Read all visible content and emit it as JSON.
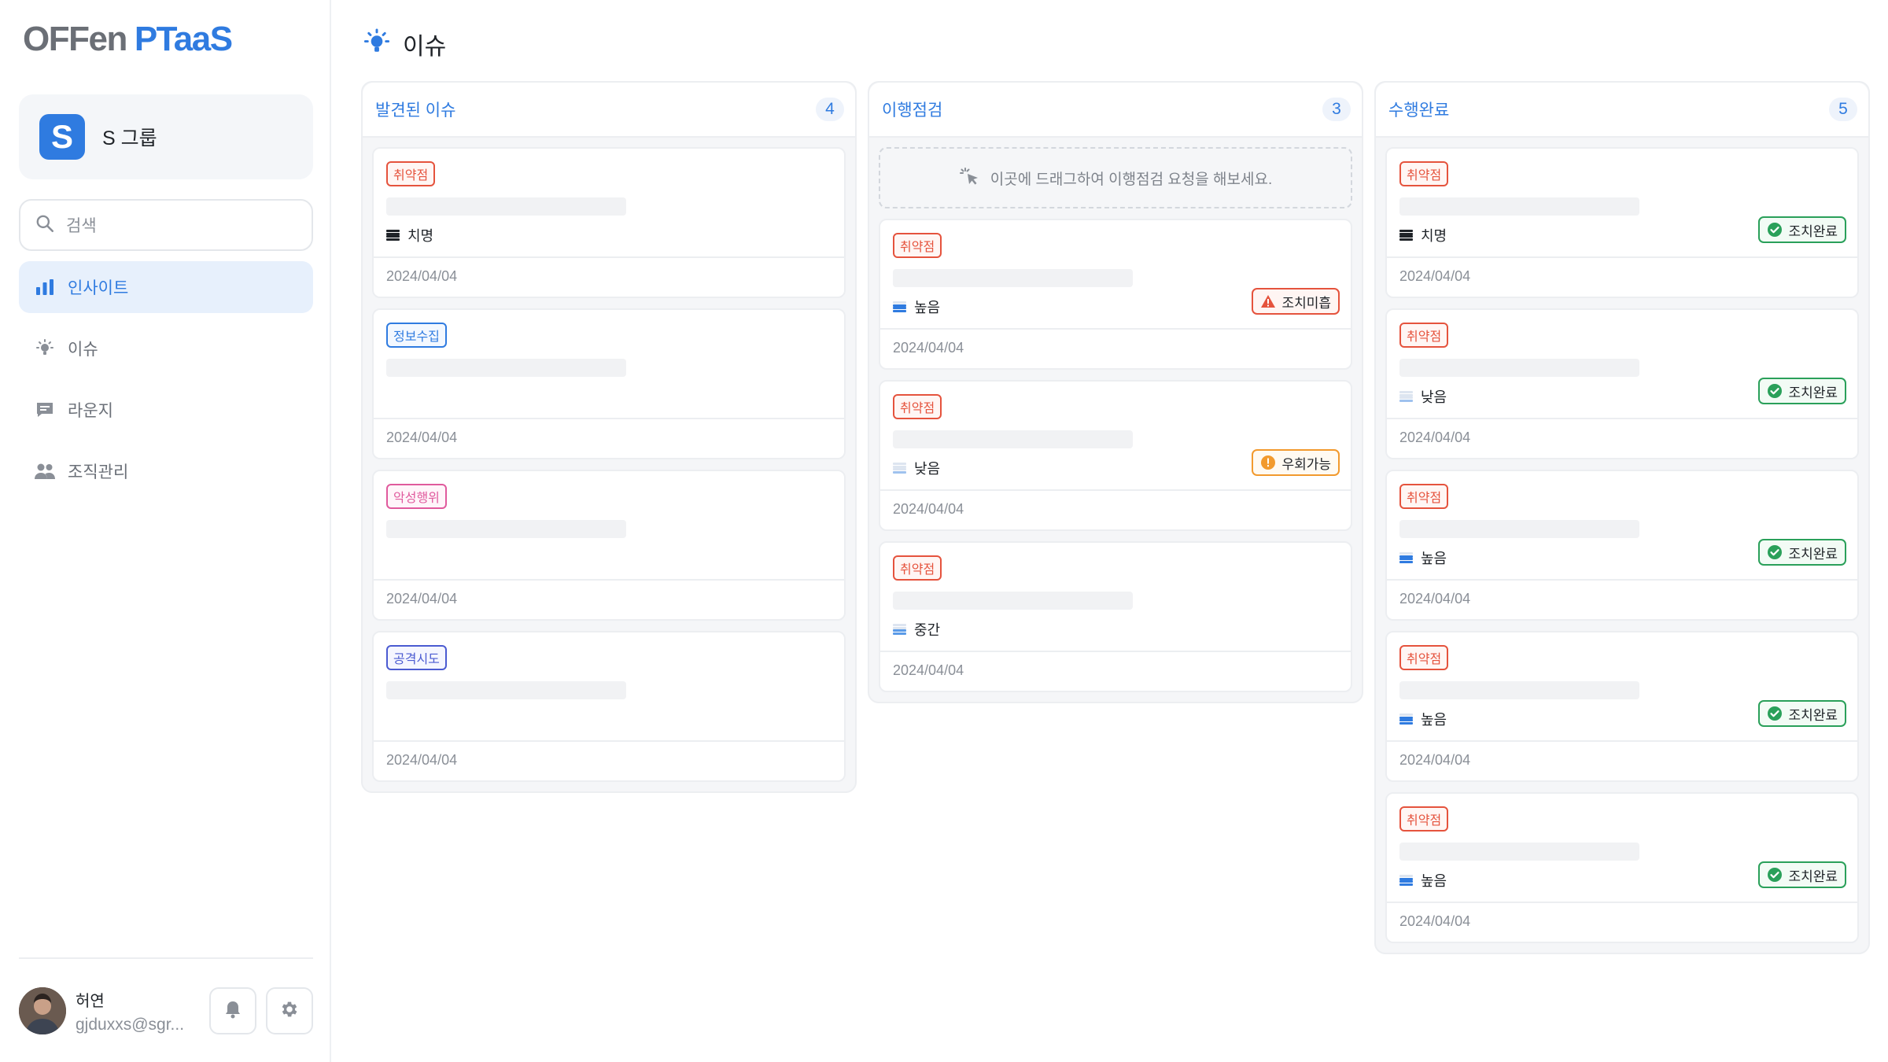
{
  "app": {
    "logo_part1": "OFFen",
    "logo_part2": "PTaaS"
  },
  "org": {
    "badge": "S",
    "name": "S 그룹"
  },
  "search": {
    "placeholder": "검색"
  },
  "nav": [
    {
      "label": "인사이트",
      "icon": "bar-chart-icon",
      "active": true
    },
    {
      "label": "이슈",
      "icon": "lightbulb-icon",
      "active": false
    },
    {
      "label": "라운지",
      "icon": "chat-icon",
      "active": false
    },
    {
      "label": "조직관리",
      "icon": "people-icon",
      "active": false
    }
  ],
  "user": {
    "name": "허연",
    "email": "gjduxxs@sgr..."
  },
  "page": {
    "title": "이슈",
    "icon": "lightbulb-icon"
  },
  "colors": {
    "accent": "#2f7be0",
    "vuln": "#e5533d",
    "info": "#2f7be0",
    "malicious": "#e05a9d",
    "attack": "#4b5bd1",
    "done": "#2aa05a",
    "bypass": "#f29a2e"
  },
  "columns": [
    {
      "title": "발견된 이슈",
      "count": "4",
      "cards": [
        {
          "tag": "취약점",
          "tag_type": "vuln",
          "severity": "치명",
          "severity_level": "critical",
          "status": "",
          "status_type": "",
          "date": "2024/04/04"
        },
        {
          "tag": "정보수집",
          "tag_type": "info",
          "severity": "",
          "severity_level": "",
          "status": "",
          "status_type": "",
          "date": "2024/04/04"
        },
        {
          "tag": "악성행위",
          "tag_type": "mal",
          "severity": "",
          "severity_level": "",
          "status": "",
          "status_type": "",
          "date": "2024/04/04"
        },
        {
          "tag": "공격시도",
          "tag_type": "atk",
          "severity": "",
          "severity_level": "",
          "status": "",
          "status_type": "",
          "date": "2024/04/04"
        }
      ]
    },
    {
      "title": "이행점검",
      "count": "3",
      "drop_hint": "이곳에 드래그하여 이행점검 요청을 해보세요.",
      "cards": [
        {
          "tag": "취약점",
          "tag_type": "vuln",
          "severity": "높음",
          "severity_level": "high",
          "status": "조치미흡",
          "status_type": "undone",
          "date": "2024/04/04"
        },
        {
          "tag": "취약점",
          "tag_type": "vuln",
          "severity": "낮음",
          "severity_level": "low",
          "status": "우회가능",
          "status_type": "bypass",
          "date": "2024/04/04"
        },
        {
          "tag": "취약점",
          "tag_type": "vuln",
          "severity": "중간",
          "severity_level": "medium",
          "status": "",
          "status_type": "",
          "date": "2024/04/04"
        }
      ]
    },
    {
      "title": "수행완료",
      "count": "5",
      "cards": [
        {
          "tag": "취약점",
          "tag_type": "vuln",
          "severity": "치명",
          "severity_level": "critical",
          "status": "조치완료",
          "status_type": "done",
          "date": "2024/04/04"
        },
        {
          "tag": "취약점",
          "tag_type": "vuln",
          "severity": "낮음",
          "severity_level": "low",
          "status": "조치완료",
          "status_type": "done",
          "date": "2024/04/04"
        },
        {
          "tag": "취약점",
          "tag_type": "vuln",
          "severity": "높음",
          "severity_level": "high",
          "status": "조치완료",
          "status_type": "done",
          "date": "2024/04/04"
        },
        {
          "tag": "취약점",
          "tag_type": "vuln",
          "severity": "높음",
          "severity_level": "high",
          "status": "조치완료",
          "status_type": "done",
          "date": "2024/04/04"
        },
        {
          "tag": "취약점",
          "tag_type": "vuln",
          "severity": "높음",
          "severity_level": "high",
          "status": "조치완료",
          "status_type": "done",
          "date": "2024/04/04"
        }
      ]
    }
  ]
}
